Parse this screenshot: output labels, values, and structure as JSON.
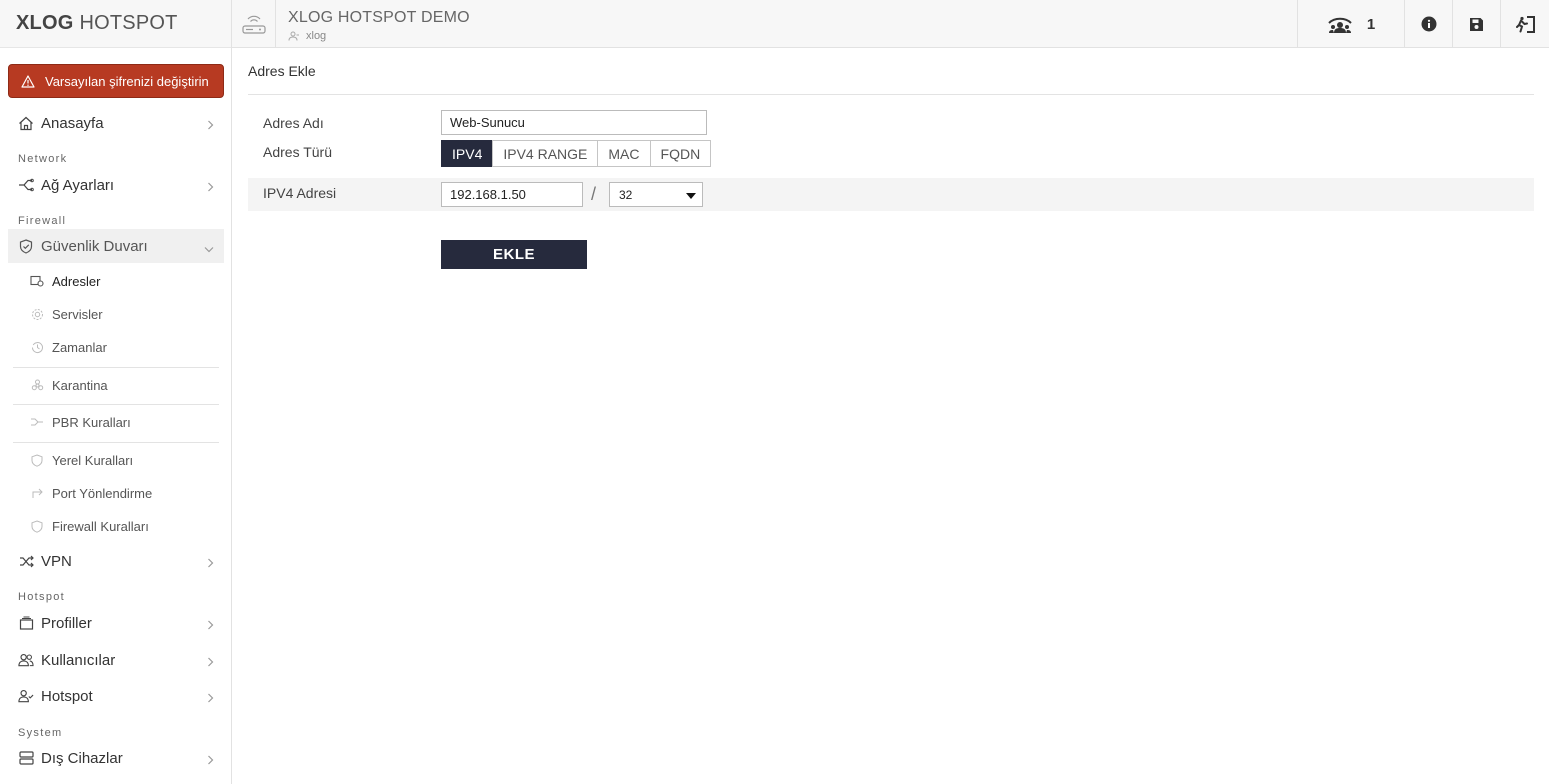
{
  "brand": {
    "bold": "XLOG",
    "rest": "HOTSPOT"
  },
  "alert": {
    "label": "Varsayılan şifrenizi değiştirin",
    "color": "#b73a22"
  },
  "sidebar": {
    "home": "Anasayfa",
    "sections": {
      "network": "Network",
      "firewall": "Firewall",
      "hotspot": "Hotspot",
      "system": "System"
    },
    "network_item": "Ağ Ayarları",
    "firewall_item": "Güvenlik Duvarı",
    "firewall_sub": [
      "Adresler",
      "Servisler",
      "Zamanlar",
      "Karantina",
      "PBR Kuralları",
      "Yerel Kuralları",
      "Port Yönlendirme",
      "Firewall Kuralları"
    ],
    "vpn": "VPN",
    "profiles": "Profiller",
    "users": "Kullanıcılar",
    "hotspot_item": "Hotspot",
    "external": "Dış Cihazlar"
  },
  "topbar": {
    "device_title": "XLOG HOTSPOT DEMO",
    "device_user": "xlog",
    "online_count": "1",
    "icons": [
      "router-icon",
      "online-users-icon",
      "info-icon",
      "save-icon",
      "logout-icon"
    ]
  },
  "form": {
    "title": "Adres Ekle",
    "name_label": "Adres Adı",
    "name_value": "Web-Sunucu",
    "type_label": "Adres Türü",
    "types": [
      "IPV4",
      "IPV4 RANGE",
      "MAC",
      "FQDN"
    ],
    "selected_type": "IPV4",
    "ip_label": "IPV4 Adresi",
    "ip_value": "192.168.1.50",
    "separator": "/",
    "mask_value": "32",
    "submit": "EKLE"
  },
  "colors": {
    "dark": "#262a3d",
    "alert": "#b73a22"
  }
}
